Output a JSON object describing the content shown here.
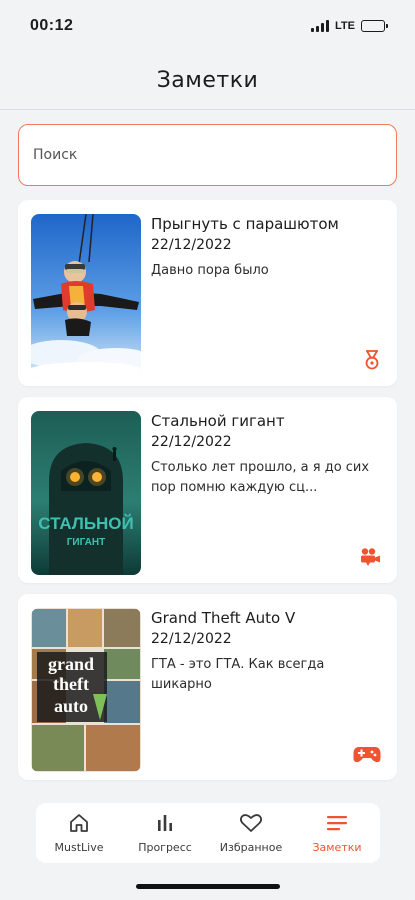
{
  "status": {
    "time": "00:12",
    "network": "LTE",
    "battery_level": 0.85
  },
  "header": {
    "title": "Заметки"
  },
  "search": {
    "placeholder": "Поиск"
  },
  "notes": [
    {
      "title": "Прыгнуть с парашютом",
      "date": "22/12/2022",
      "text": "Давно пора было",
      "category_icon": "medal-icon"
    },
    {
      "title": "Стальной гигант",
      "date": "22/12/2022",
      "text": "Столько лет прошло, а я до сих пор помню каждую сц...",
      "category_icon": "movie-camera-icon",
      "poster_text_line1": "СТАЛЬНОЙ",
      "poster_text_line2": "ГИГАНТ"
    },
    {
      "title": "Grand Theft Auto V",
      "date": "22/12/2022",
      "text": "ГТА - это ГТА. Как всегда шикарно",
      "category_icon": "gamepad-icon",
      "poster_text_line1": "grand",
      "poster_text_line2": "theft",
      "poster_text_line3": "auto"
    }
  ],
  "tabbar": {
    "tabs": [
      {
        "label": "MustLive",
        "icon": "home-icon"
      },
      {
        "label": "Прогресс",
        "icon": "bar-chart-icon"
      },
      {
        "label": "Избранное",
        "icon": "heart-icon"
      },
      {
        "label": "Заметки",
        "icon": "notes-lines-icon",
        "active": true
      }
    ]
  },
  "colors": {
    "accent": "#ef5331",
    "search_border": "#f2795a",
    "background": "#f1f3f5"
  }
}
